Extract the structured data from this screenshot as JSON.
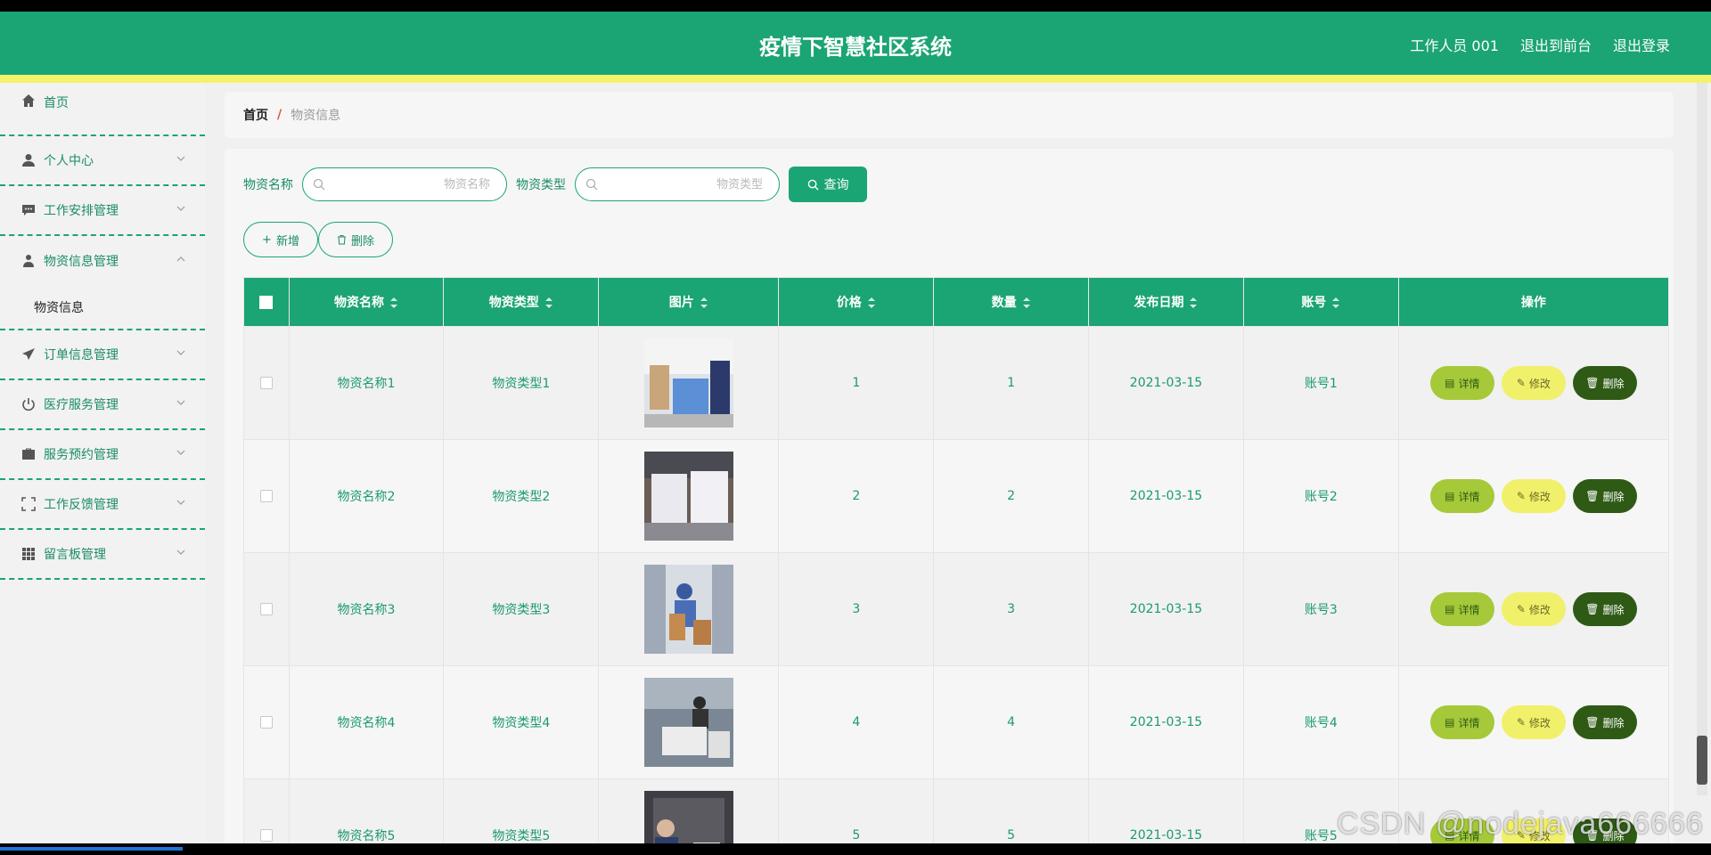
{
  "header": {
    "title": "疫情下智慧社区系统",
    "user": "工作人员 001",
    "to_front": "退出到前台",
    "logout": "退出登录"
  },
  "sidebar": {
    "items": [
      {
        "label": "首页",
        "icon": "home-icon"
      },
      {
        "label": "个人中心",
        "icon": "user-icon"
      },
      {
        "label": "工作安排管理",
        "icon": "chat-icon"
      },
      {
        "label": "物资信息管理",
        "icon": "person-icon",
        "open": true,
        "children": [
          "物资信息"
        ]
      },
      {
        "label": "订单信息管理",
        "icon": "send-icon"
      },
      {
        "label": "医疗服务管理",
        "icon": "power-icon"
      },
      {
        "label": "服务预约管理",
        "icon": "briefcase-icon"
      },
      {
        "label": "工作反馈管理",
        "icon": "fullscreen-icon"
      },
      {
        "label": "留言板管理",
        "icon": "grid-icon"
      }
    ]
  },
  "breadcrumb": {
    "home": "首页",
    "separator": "/",
    "current": "物资信息"
  },
  "search": {
    "name_label": "物资名称",
    "name_placeholder": "物资名称",
    "type_label": "物资类型",
    "type_placeholder": "物资类型",
    "query_button": "查询"
  },
  "actions": {
    "add": "新增",
    "delete": "删除"
  },
  "table": {
    "columns": [
      "物资名称",
      "物资类型",
      "图片",
      "价格",
      "数量",
      "发布日期",
      "账号",
      "操作"
    ],
    "rows": [
      {
        "name": "物资名称1",
        "type": "物资类型1",
        "price": "1",
        "qty": "1",
        "date": "2021-03-15",
        "account": "账号1"
      },
      {
        "name": "物资名称2",
        "type": "物资类型2",
        "price": "2",
        "qty": "2",
        "date": "2021-03-15",
        "account": "账号2"
      },
      {
        "name": "物资名称3",
        "type": "物资类型3",
        "price": "3",
        "qty": "3",
        "date": "2021-03-15",
        "account": "账号3"
      },
      {
        "name": "物资名称4",
        "type": "物资类型4",
        "price": "4",
        "qty": "4",
        "date": "2021-03-15",
        "account": "账号4"
      },
      {
        "name": "物资名称5",
        "type": "物资类型5",
        "price": "5",
        "qty": "5",
        "date": "2021-03-15",
        "account": "账号5"
      }
    ],
    "row_actions": {
      "detail": "详情",
      "edit": "修改",
      "delete": "删除"
    }
  },
  "watermark": "CSDN @nodejava666666",
  "colors": {
    "primary": "#1ba474",
    "accent_yellow": "#f4f26b",
    "detail": "#a6c93a",
    "edit": "#f1f06a",
    "delete": "#2e5a16"
  }
}
